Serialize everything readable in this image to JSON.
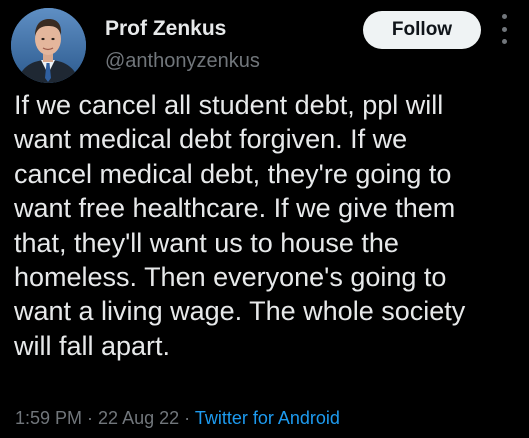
{
  "author": {
    "name": "Prof Zenkus",
    "handle": "@anthonyzenkus"
  },
  "follow_button": {
    "label": "Follow"
  },
  "more_icon": "more-vertical-icon",
  "tweet": {
    "lines": [
      "If we cancel all student debt, ppl will",
      "want medical debt forgiven. If we",
      "cancel medical debt, they're going to",
      "want free healthcare. If we give them",
      "that, they'll want us to house the",
      "homeless. Then everyone's going to",
      "want a living wage. The whole society",
      "will fall apart."
    ]
  },
  "meta": {
    "time": "1:59 PM",
    "separator_1": " · ",
    "date": "22 Aug 22",
    "separator_2": " · ",
    "source": "Twitter for Android"
  },
  "colors": {
    "background": "#000000",
    "text": "#e7e9ea",
    "secondary": "#71767b",
    "link": "#1d9bf0",
    "button_bg": "#eff3f4"
  }
}
